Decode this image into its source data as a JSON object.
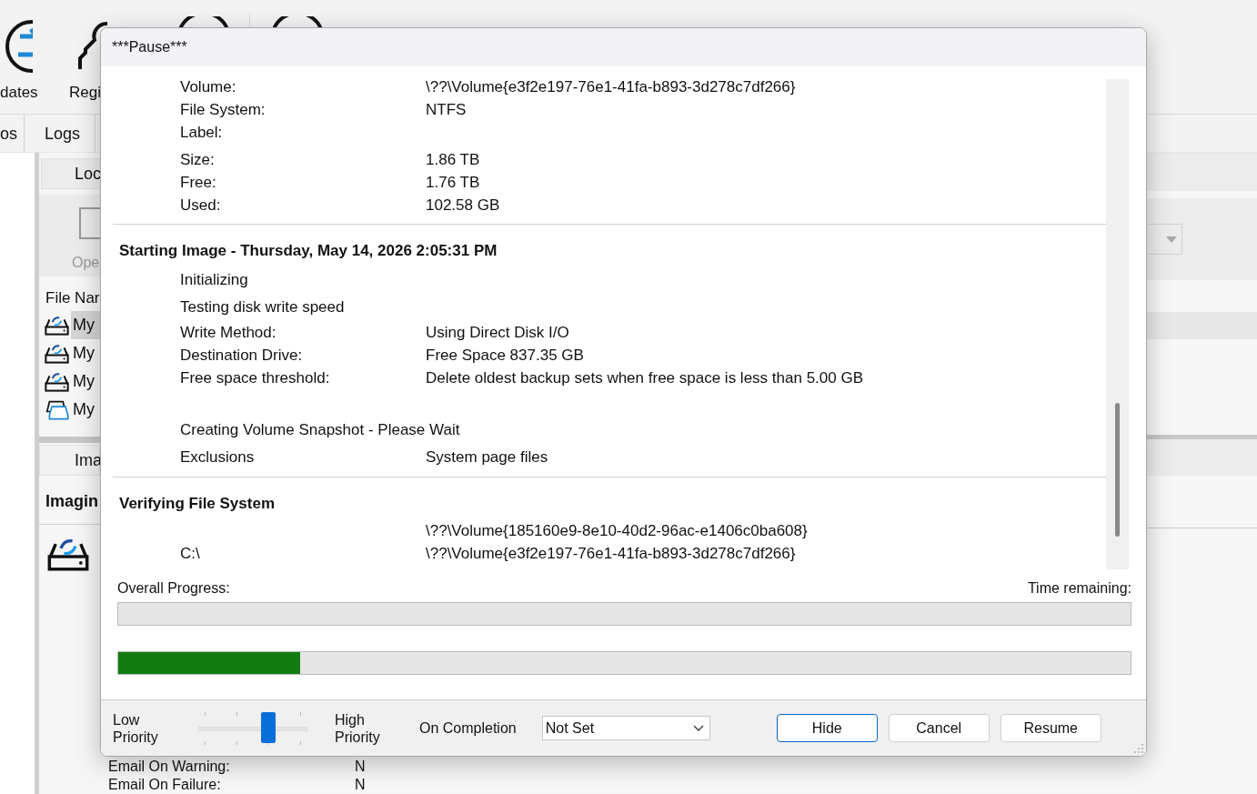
{
  "background": {
    "toolbar": [
      {
        "label": "dates"
      },
      {
        "label": "Regi"
      }
    ],
    "tabs": [
      {
        "label": "os"
      },
      {
        "label": "Logs"
      }
    ],
    "location_tab": "Loc",
    "open_button": "Ope",
    "file_list": {
      "header": "File Nar",
      "rows": [
        {
          "name": "My",
          "kind": "image",
          "selected": true
        },
        {
          "name": "My",
          "kind": "image",
          "selected": false
        },
        {
          "name": "My",
          "kind": "image",
          "selected": false
        },
        {
          "name": "My",
          "kind": "stack",
          "selected": false
        }
      ]
    },
    "image_button": "Ima",
    "section_title": "Imagin",
    "details": [
      {
        "label": "Email On Warning:",
        "value": "N"
      },
      {
        "label": "Email On Failure:",
        "value": "N"
      }
    ]
  },
  "dialog": {
    "title": "***Pause***",
    "log": [
      {
        "rows": [
          {
            "kind": "pair",
            "label": "Volume:",
            "value": "\\??\\Volume{e3f2e197-76e1-41fa-b893-3d278c7df266}"
          },
          {
            "kind": "pair",
            "label": "File System:",
            "value": "NTFS"
          },
          {
            "kind": "pair",
            "label": "Label:"
          },
          {
            "kind": "spacer"
          },
          {
            "kind": "pair",
            "label": "Size:",
            "value": "1.86 TB"
          },
          {
            "kind": "pair",
            "label": "Free:",
            "value": "1.76 TB"
          },
          {
            "kind": "pair",
            "label": "Used:",
            "value": "102.58 GB"
          }
        ]
      },
      {
        "heading": "Starting Image - Thursday, May 14, 2026 2:05:31 PM",
        "rows": [
          {
            "kind": "step",
            "label": "Initializing"
          },
          {
            "kind": "step",
            "label": "Testing disk write speed"
          },
          {
            "kind": "pair",
            "label": "Write Method:",
            "value": "Using Direct Disk I/O"
          },
          {
            "kind": "pair",
            "label": "Destination Drive:",
            "value": "Free Space 837.35 GB"
          },
          {
            "kind": "pair",
            "label": "Free space threshold:",
            "value": "Delete oldest backup sets when free space is less than 5.00 GB"
          },
          {
            "kind": "gap"
          },
          {
            "kind": "step",
            "label": "Creating Volume Snapshot - Please Wait"
          },
          {
            "kind": "step",
            "label": "Exclusions",
            "value": "System page files"
          }
        ]
      },
      {
        "heading": "Verifying File System",
        "rows": [
          {
            "kind": "pair",
            "value": "\\??\\Volume{185160e9-8e10-40d2-96ac-e1406c0ba608}"
          },
          {
            "kind": "pair",
            "label": "C:\\",
            "value": "\\??\\Volume{e3f2e197-76e1-41fa-b893-3d278c7df266}"
          }
        ]
      }
    ],
    "overall_progress_label": "Overall Progress:",
    "time_remaining_label": "Time remaining:",
    "progress_bars": [
      {
        "level": 0
      },
      {
        "level": 0.18
      }
    ],
    "priority": {
      "low_label": "Low Priority",
      "high_label": "High Priority",
      "level": 0.67
    },
    "on_completion": {
      "label": "On Completion",
      "value": "Not Set"
    },
    "buttons": [
      {
        "label": "Hide",
        "focused": true
      },
      {
        "label": "Cancel",
        "focused": false
      },
      {
        "label": "Resume",
        "focused": false
      }
    ]
  }
}
